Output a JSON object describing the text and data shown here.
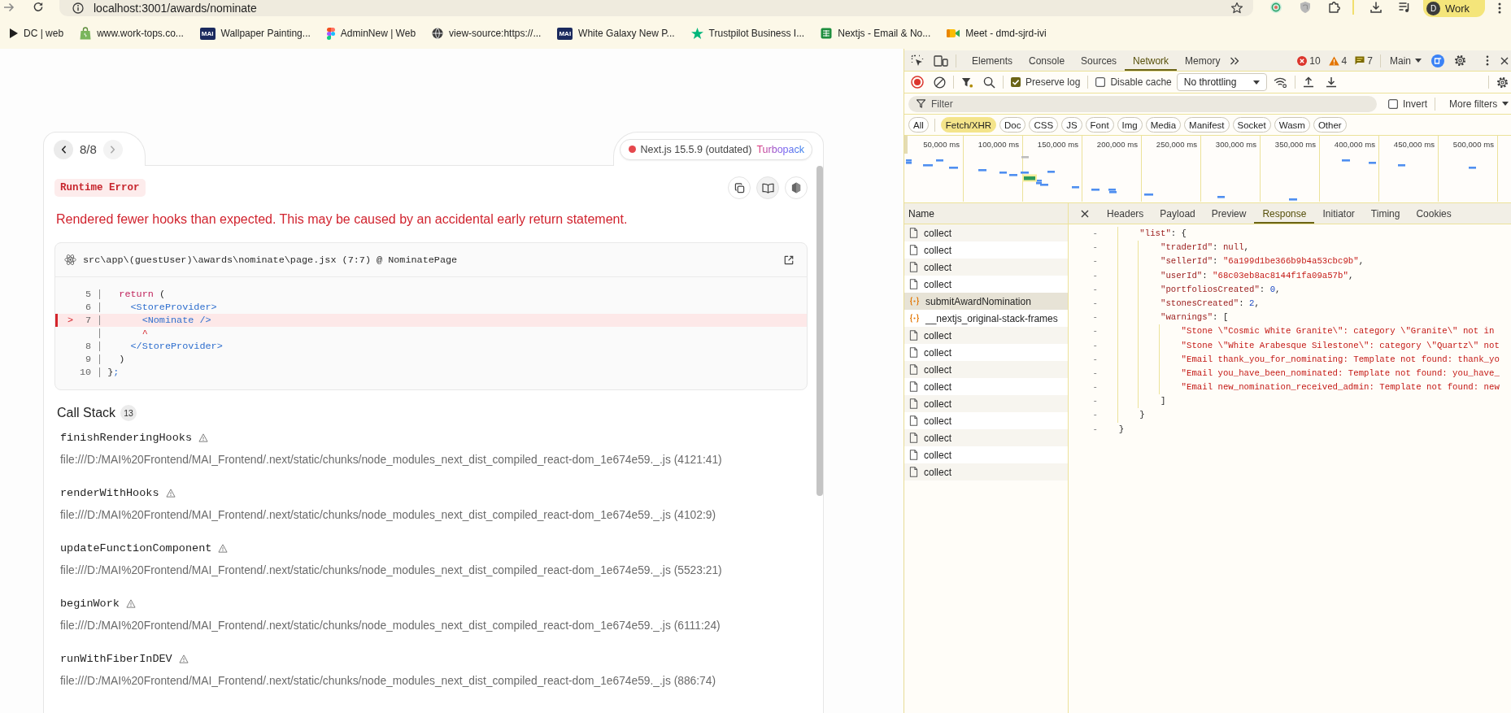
{
  "browser": {
    "url": "localhost:3001/awards/nominate",
    "profile": {
      "initial": "D",
      "label": "Work"
    },
    "bookmarks": [
      {
        "kind": "play",
        "label": "DC | web"
      },
      {
        "kind": "bag",
        "label": "www.work-tops.co..."
      },
      {
        "kind": "logo",
        "logo_text": "MAI",
        "label": "Wallpaper Painting..."
      },
      {
        "kind": "shapes",
        "label": "AdminNew | Web"
      },
      {
        "kind": "globe",
        "label": "view-source:https://..."
      },
      {
        "kind": "logo",
        "logo_text": "MAI",
        "label": "White Galaxy New P..."
      },
      {
        "kind": "star",
        "label": "Trustpilot Business I..."
      },
      {
        "kind": "sheet",
        "label": "Nextjs - Email & No..."
      },
      {
        "kind": "camera",
        "label": "Meet - dmd-sjrd-ivi"
      }
    ]
  },
  "error_overlay": {
    "nav": {
      "counter": "8/8",
      "prev_disabled": false,
      "next_disabled": true
    },
    "version_badge": {
      "label": "Next.js 15.5.9 (outdated)",
      "bundler": "Turbopack"
    },
    "error_type": "Runtime Error",
    "message": "Rendered fewer hooks than expected. This may be caused by an accidental early return statement.",
    "code_frame": {
      "file": "src\\app\\(guestUser)\\awards\\nominate\\page.jsx (7:7) @ NominatePage",
      "lines": [
        {
          "number": "5",
          "highlighted": false,
          "tokens": [
            {
              "text": "  return",
              "kind": "keyword"
            },
            {
              "text": " (",
              "kind": "plain"
            }
          ]
        },
        {
          "number": "6",
          "highlighted": false,
          "tokens": [
            {
              "text": "    <StoreProvider>",
              "kind": "tag"
            }
          ]
        },
        {
          "number": "7",
          "highlighted": true,
          "marker": ">",
          "tokens": [
            {
              "text": "      <Nominate />",
              "kind": "tag"
            }
          ]
        },
        {
          "highlighted": false,
          "tokens": [
            {
              "text": "      ^",
              "kind": "caret"
            }
          ]
        },
        {
          "number": "8",
          "highlighted": false,
          "tokens": [
            {
              "text": "    </StoreProvider>",
              "kind": "tag"
            }
          ]
        },
        {
          "number": "9",
          "highlighted": false,
          "tokens": [
            {
              "text": "  )",
              "kind": "plain"
            }
          ]
        },
        {
          "number": "10",
          "highlighted": false,
          "tokens": [
            {
              "text": "}",
              "kind": "plain"
            },
            {
              "text": ";",
              "kind": "tag"
            }
          ]
        }
      ]
    },
    "call_stack": {
      "title": "Call Stack",
      "count": "13",
      "frames": [
        {
          "name": "finishRenderingHooks",
          "location": "file:///D:/MAI%20Frontend/MAI_Frontend/.next/static/chunks/node_modules_next_dist_compiled_react-dom_1e674e59._.js (4121:41)"
        },
        {
          "name": "renderWithHooks",
          "location": "file:///D:/MAI%20Frontend/MAI_Frontend/.next/static/chunks/node_modules_next_dist_compiled_react-dom_1e674e59._.js (4102:9)"
        },
        {
          "name": "updateFunctionComponent",
          "location": "file:///D:/MAI%20Frontend/MAI_Frontend/.next/static/chunks/node_modules_next_dist_compiled_react-dom_1e674e59._.js (5523:21)"
        },
        {
          "name": "beginWork",
          "location": "file:///D:/MAI%20Frontend/MAI_Frontend/.next/static/chunks/node_modules_next_dist_compiled_react-dom_1e674e59._.js (6111:24)"
        },
        {
          "name": "runWithFiberInDEV",
          "location": "file:///D:/MAI%20Frontend/MAI_Frontend/.next/static/chunks/node_modules_next_dist_compiled_react-dom_1e674e59._.js (886:74)"
        }
      ]
    }
  },
  "devtools": {
    "panel_tabs": [
      {
        "label": "Elements",
        "selected": false
      },
      {
        "label": "Console",
        "selected": false
      },
      {
        "label": "Sources",
        "selected": false
      },
      {
        "label": "Network",
        "selected": true
      },
      {
        "label": "Memory",
        "selected": false
      }
    ],
    "counts": {
      "errors": "10",
      "warnings": "4",
      "messages": "7"
    },
    "context": "Main",
    "network": {
      "preserve_log": {
        "label": "Preserve log",
        "checked": true
      },
      "disable_cache": {
        "label": "Disable cache",
        "checked": false
      },
      "throttling": "No throttling",
      "filter": {
        "placeholder": "Filter"
      },
      "invert": {
        "label": "Invert",
        "checked": false
      },
      "more_filters": "More filters",
      "type_filters": [
        {
          "label": "All",
          "selected": false
        },
        {
          "label": "Fetch/XHR",
          "selected": true
        },
        {
          "label": "Doc",
          "selected": false
        },
        {
          "label": "CSS",
          "selected": false
        },
        {
          "label": "JS",
          "selected": false
        },
        {
          "label": "Font",
          "selected": false
        },
        {
          "label": "Img",
          "selected": false
        },
        {
          "label": "Media",
          "selected": false
        },
        {
          "label": "Manifest",
          "selected": false
        },
        {
          "label": "Socket",
          "selected": false
        },
        {
          "label": "Wasm",
          "selected": false
        },
        {
          "label": "Other",
          "selected": false
        }
      ],
      "overview": {
        "tick_labels": [
          "50,000 ms",
          "100,000 ms",
          "150,000 ms",
          "200,000 ms",
          "250,000 ms",
          "300,000 ms",
          "350,000 ms",
          "400,000 ms",
          "450,000 ms",
          "500,000 ms"
        ]
      },
      "requests": {
        "column": "Name",
        "rows": [
          {
            "name": "collect",
            "kind": "document",
            "selected": false
          },
          {
            "name": "collect",
            "kind": "document",
            "selected": false
          },
          {
            "name": "collect",
            "kind": "document",
            "selected": false
          },
          {
            "name": "collect",
            "kind": "document",
            "selected": false
          },
          {
            "name": "submitAwardNomination",
            "kind": "fetch",
            "selected": true
          },
          {
            "name": "__nextjs_original-stack-frames",
            "kind": "fetch",
            "selected": false
          },
          {
            "name": "collect",
            "kind": "document",
            "selected": false
          },
          {
            "name": "collect",
            "kind": "document",
            "selected": false
          },
          {
            "name": "collect",
            "kind": "document",
            "selected": false
          },
          {
            "name": "collect",
            "kind": "document",
            "selected": false
          },
          {
            "name": "collect",
            "kind": "document",
            "selected": false
          },
          {
            "name": "collect",
            "kind": "document",
            "selected": false
          },
          {
            "name": "collect",
            "kind": "document",
            "selected": false
          },
          {
            "name": "collect",
            "kind": "document",
            "selected": false
          },
          {
            "name": "collect",
            "kind": "document",
            "selected": false
          }
        ]
      },
      "detail_tabs": [
        {
          "label": "Headers",
          "selected": false
        },
        {
          "label": "Payload",
          "selected": false
        },
        {
          "label": "Preview",
          "selected": false
        },
        {
          "label": "Response",
          "selected": true
        },
        {
          "label": "Initiator",
          "selected": false
        },
        {
          "label": "Timing",
          "selected": false
        },
        {
          "label": "Cookies",
          "selected": false
        }
      ],
      "response_lines": [
        {
          "marker": "-",
          "tokens": [
            {
              "text": "        \"list\"",
              "kind": "key"
            },
            {
              "text": ": {",
              "kind": "punct"
            }
          ]
        },
        {
          "marker": "-",
          "tokens": [
            {
              "text": "            \"traderId\"",
              "kind": "key"
            },
            {
              "text": ": ",
              "kind": "punct"
            },
            {
              "text": "null",
              "kind": "null"
            },
            {
              "text": ",",
              "kind": "punct"
            }
          ]
        },
        {
          "marker": "-",
          "tokens": [
            {
              "text": "            \"sellerId\"",
              "kind": "key"
            },
            {
              "text": ": ",
              "kind": "punct"
            },
            {
              "text": "\"6a199d1be366b9b4a53cbc9b\"",
              "kind": "string"
            },
            {
              "text": ",",
              "kind": "punct"
            }
          ]
        },
        {
          "marker": "-",
          "tokens": [
            {
              "text": "            \"userId\"",
              "kind": "key"
            },
            {
              "text": ": ",
              "kind": "punct"
            },
            {
              "text": "\"68c03eb8ac8144f1fa09a57b\"",
              "kind": "string"
            },
            {
              "text": ",",
              "kind": "punct"
            }
          ]
        },
        {
          "marker": "-",
          "tokens": [
            {
              "text": "            \"portfoliosCreated\"",
              "kind": "key"
            },
            {
              "text": ": ",
              "kind": "punct"
            },
            {
              "text": "0",
              "kind": "number"
            },
            {
              "text": ",",
              "kind": "punct"
            }
          ]
        },
        {
          "marker": "-",
          "tokens": [
            {
              "text": "            \"stonesCreated\"",
              "kind": "key"
            },
            {
              "text": ": ",
              "kind": "punct"
            },
            {
              "text": "2",
              "kind": "number"
            },
            {
              "text": ",",
              "kind": "punct"
            }
          ]
        },
        {
          "marker": "-",
          "tokens": [
            {
              "text": "            \"warnings\"",
              "kind": "key"
            },
            {
              "text": ": [",
              "kind": "punct"
            }
          ]
        },
        {
          "marker": "-",
          "tokens": [
            {
              "text": "                \"Stone \\\"Cosmic White Granite\\\": category \\\"Granite\\\" not in",
              "kind": "string"
            }
          ]
        },
        {
          "marker": "-",
          "tokens": [
            {
              "text": "                \"Stone \\\"White Arabesque Silestone\\\": category \\\"Quartz\\\" not",
              "kind": "string"
            }
          ]
        },
        {
          "marker": "-",
          "tokens": [
            {
              "text": "                \"Email thank_you_for_nominating: Template not found: thank_yo",
              "kind": "string"
            }
          ]
        },
        {
          "marker": "-",
          "tokens": [
            {
              "text": "                \"Email you_have_been_nominated: Template not found: you_have_",
              "kind": "string"
            }
          ]
        },
        {
          "marker": "-",
          "tokens": [
            {
              "text": "                \"Email new_nomination_received_admin: Template not found: new",
              "kind": "string"
            }
          ]
        },
        {
          "marker": "-",
          "tokens": [
            {
              "text": "            ]",
              "kind": "punct"
            }
          ]
        },
        {
          "marker": "-",
          "tokens": [
            {
              "text": "        }",
              "kind": "punct"
            }
          ]
        },
        {
          "marker": "-",
          "tokens": [
            {
              "text": "    }",
              "kind": "punct"
            }
          ]
        }
      ]
    }
  }
}
